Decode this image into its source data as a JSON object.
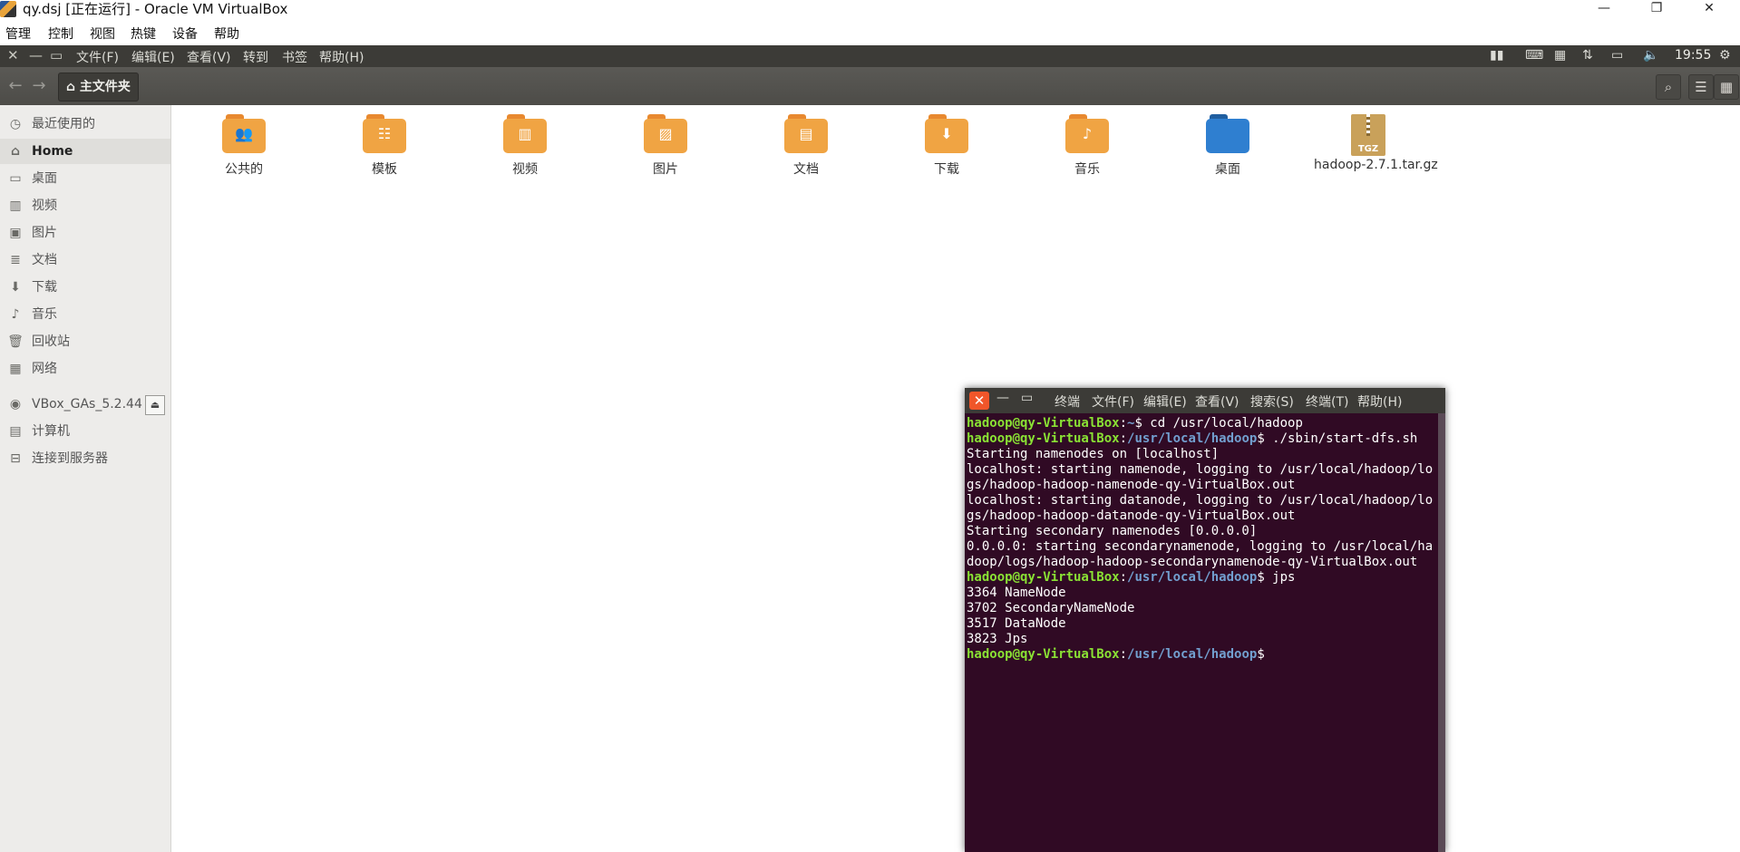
{
  "host_window": {
    "title": "qy.dsj [正在运行] - Oracle VM VirtualBox",
    "minimize": "—",
    "maximize": "❐",
    "close": "✕"
  },
  "vbox_menu": [
    "管理",
    "控制",
    "视图",
    "热键",
    "设备",
    "帮助"
  ],
  "ubuntu_panel": {
    "window_controls": [
      "✕",
      "—",
      "▭"
    ],
    "menus": [
      "文件(F)",
      "编辑(E)",
      "查看(V)",
      "转到",
      "书签",
      "帮助(H)"
    ],
    "time": "19:55"
  },
  "toolbar": {
    "back": "←",
    "forward": "→",
    "path_home": "⌂ 主文件夹",
    "search": "⌕",
    "list_view": "☰",
    "grid_view": "▦"
  },
  "sidebar": {
    "items": [
      {
        "label": "最近使用的",
        "icon": "clock-icon",
        "glyph": "◷"
      },
      {
        "label": "Home",
        "icon": "home-icon",
        "glyph": "⌂"
      },
      {
        "label": "桌面",
        "icon": "desktop-icon",
        "glyph": "▭"
      },
      {
        "label": "视频",
        "icon": "video-icon",
        "glyph": "▥"
      },
      {
        "label": "图片",
        "icon": "picture-icon",
        "glyph": "▣"
      },
      {
        "label": "文档",
        "icon": "document-icon",
        "glyph": "≣"
      },
      {
        "label": "下载",
        "icon": "download-icon",
        "glyph": "⬇"
      },
      {
        "label": "音乐",
        "icon": "music-icon",
        "glyph": "♪"
      },
      {
        "label": "回收站",
        "icon": "trash-icon",
        "glyph": "🗑"
      },
      {
        "label": "网络",
        "icon": "network-icon",
        "glyph": "▦"
      },
      {
        "label": "VBox_GAs_5.2.44",
        "icon": "disc-icon",
        "glyph": "◉"
      },
      {
        "label": "计算机",
        "icon": "computer-icon",
        "glyph": "▤"
      },
      {
        "label": "连接到服务器",
        "icon": "server-icon",
        "glyph": "⊟"
      }
    ],
    "eject": "⏏"
  },
  "files": [
    {
      "name": "公共的",
      "glyph": "👥"
    },
    {
      "name": "模板",
      "glyph": "☷"
    },
    {
      "name": "视频",
      "glyph": "▥"
    },
    {
      "name": "图片",
      "glyph": "▨"
    },
    {
      "name": "文档",
      "glyph": "▤"
    },
    {
      "name": "下载",
      "glyph": "⬇"
    },
    {
      "name": "音乐",
      "glyph": "♪"
    },
    {
      "name": "桌面",
      "glyph": ""
    },
    {
      "name": "hadoop-2.7.1.tar.gz",
      "glyph": "TGZ"
    }
  ],
  "terminal": {
    "close": "✕",
    "minimize": "—",
    "maximize": "▭",
    "menus": [
      "终端",
      "文件(F)",
      "编辑(E)",
      "查看(V)",
      "搜索(S)",
      "终端(T)",
      "帮助(H)"
    ],
    "lines": [
      {
        "user": "hadoop@qy-VirtualBox",
        "path": "~",
        "cmd": "$ cd /usr/local/hadoop"
      },
      {
        "user": "hadoop@qy-VirtualBox",
        "path": "/usr/local/hadoop",
        "cmd": "$ ./sbin/start-dfs.sh"
      },
      {
        "text": "Starting namenodes on [localhost]"
      },
      {
        "text": "localhost: starting namenode, logging to /usr/local/hadoop/logs/hadoop-hadoop-namenode-qy-VirtualBox.out"
      },
      {
        "text": "localhost: starting datanode, logging to /usr/local/hadoop/logs/hadoop-hadoop-datanode-qy-VirtualBox.out"
      },
      {
        "text": "Starting secondary namenodes [0.0.0.0]"
      },
      {
        "text": "0.0.0.0: starting secondarynamenode, logging to /usr/local/hadoop/logs/hadoop-hadoop-secondarynamenode-qy-VirtualBox.out"
      },
      {
        "user": "hadoop@qy-VirtualBox",
        "path": "/usr/local/hadoop",
        "cmd": "$ jps"
      },
      {
        "text": "3364 NameNode"
      },
      {
        "text": "3702 SecondaryNameNode"
      },
      {
        "text": "3517 DataNode"
      },
      {
        "text": "3823 Jps"
      },
      {
        "user": "hadoop@qy-VirtualBox",
        "path": "/usr/local/hadoop",
        "cmd": "$"
      }
    ]
  }
}
